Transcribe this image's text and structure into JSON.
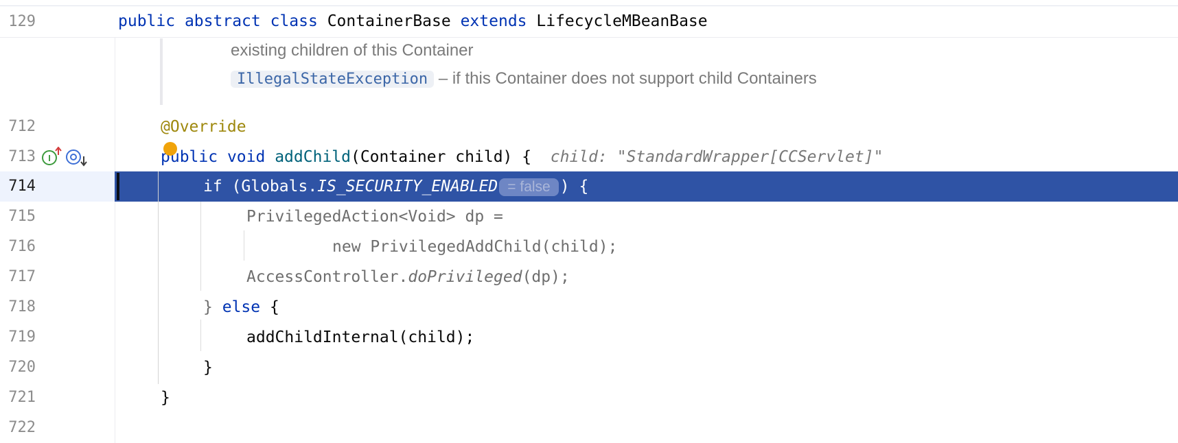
{
  "sticky": {
    "line": "129",
    "kw1": "public",
    "kw2": "abstract",
    "kw3": "class",
    "name": "ContainerBase",
    "kw4": "extends",
    "parent": "LifecycleMBeanBase"
  },
  "doc": {
    "line1": "existing children of this Container",
    "exception": "IllegalStateException",
    "line2": "– if this Container does not support child Containers"
  },
  "lines": {
    "n712": "712",
    "n713": "713",
    "n714": "714",
    "n715": "715",
    "n716": "716",
    "n717": "717",
    "n718": "718",
    "n719": "719",
    "n720": "720",
    "n721": "721",
    "n722": "722"
  },
  "code": {
    "l712": "@Override",
    "l713_public": "public",
    "l713_void": "void",
    "l713_method": "addChild",
    "l713_args": "(Container child) {",
    "l713_hint": "child: \"StandardWrapper[CCServlet]\"",
    "l714_if": "if (Globals.",
    "l714_const": "IS_SECURITY_ENABLED",
    "l714_badge": "= false",
    "l714_end": ") {",
    "l715": "PrivilegedAction<Void> dp =",
    "l716": "new PrivilegedAddChild(child);",
    "l717_a": "AccessController.",
    "l717_m": "doPrivileged",
    "l717_b": "(dp);",
    "l718_brace": "}",
    "l718_else": "else",
    "l718_open": "{",
    "l719": "addChildInternal(child);",
    "l720": "}",
    "l721": "}"
  },
  "colors": {
    "selection": "#2f53a5",
    "keyword": "#0033b3",
    "annotation": "#9e880d",
    "breakpoint": "#f0a30a"
  },
  "icons": {
    "implements": "implements-up-icon",
    "overrides": "overrides-down-icon",
    "breakpoint": "breakpoint-dot-icon"
  }
}
